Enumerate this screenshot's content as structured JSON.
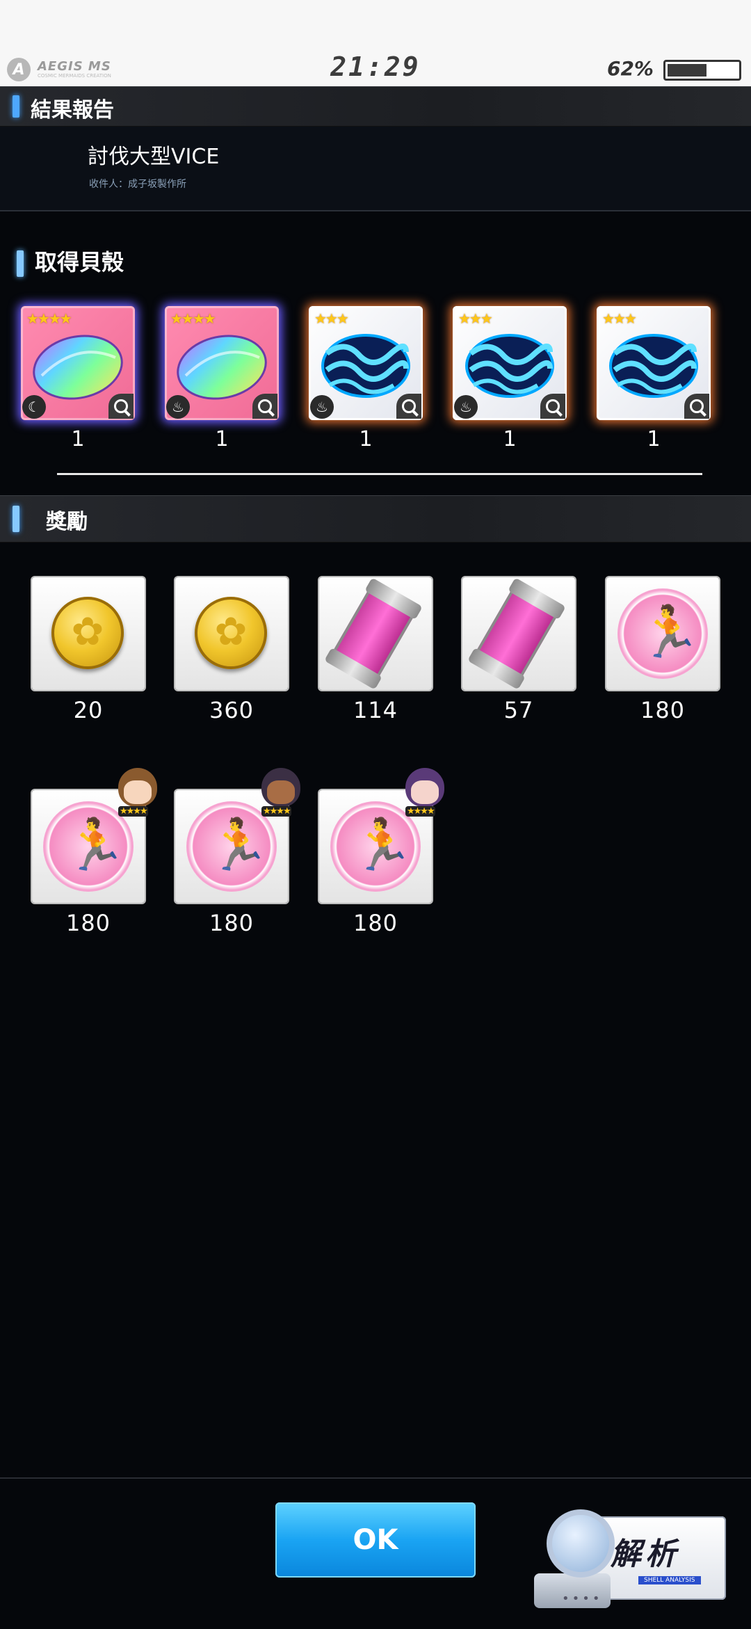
{
  "status_bar": {
    "brand": "AEGIS MS",
    "brand_sub": "COSMIC MERMAIDS CREATION",
    "time": "21:29",
    "battery": "62%",
    "battery_level": 0.62
  },
  "result_header": {
    "title": "結果報告"
  },
  "report": {
    "title": "討伐大型VICE",
    "recipient": "收件人：成子坂製作所"
  },
  "shells_section": {
    "title": "取得貝殼",
    "items": [
      {
        "stars": "★★★★",
        "type": "rainbow-shell",
        "element": "moon",
        "count": "1"
      },
      {
        "stars": "★★★★",
        "type": "rainbow-shell",
        "element": "fire",
        "count": "1"
      },
      {
        "stars": "★★★",
        "type": "blue-wave-shell",
        "element": "fire",
        "count": "1"
      },
      {
        "stars": "★★★",
        "type": "blue-wave-shell",
        "element": "fire",
        "count": "1"
      },
      {
        "stars": "★★★",
        "type": "blue-wave-shell",
        "element": "none",
        "count": "1"
      }
    ]
  },
  "rewards_section": {
    "title": "獎勵",
    "items": [
      {
        "icon": "gold-coin-icon",
        "count": "20"
      },
      {
        "icon": "gold-coin-icon",
        "count": "360"
      },
      {
        "icon": "pink-capsule-icon",
        "count": "114"
      },
      {
        "icon": "pink-capsule-icon",
        "count": "57"
      },
      {
        "icon": "exp-badge-icon",
        "count": "180"
      },
      {
        "icon": "exp-badge-icon",
        "count": "180",
        "avatar": "brown-hair"
      },
      {
        "icon": "exp-badge-icon",
        "count": "180",
        "avatar": "dark-skin"
      },
      {
        "icon": "exp-badge-icon",
        "count": "180",
        "avatar": "purple-hair"
      }
    ],
    "avatar_stars": "★★★★"
  },
  "footer": {
    "ok_label": "OK",
    "analysis_label": "解析",
    "analysis_sub": "SHELL ANALYSIS"
  }
}
